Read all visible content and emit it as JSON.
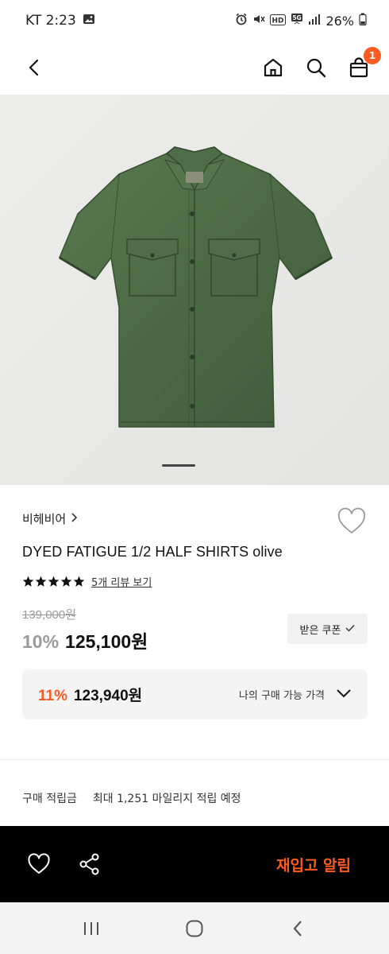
{
  "status_bar": {
    "carrier_time": "KT 2:23",
    "network": "5G",
    "hd": "HD",
    "battery": "26%"
  },
  "header": {
    "back_icon": "back-arrow-icon",
    "home_icon": "home-icon",
    "search_icon": "search-icon",
    "cart_icon": "shopping-bag-icon",
    "cart_count": "1",
    "accent_color": "#ff5a1f"
  },
  "product": {
    "brand": "비헤비어",
    "brand_chevron": "›",
    "name": "DYED FATIGUE 1/2 HALF SHIRTS olive",
    "rating_stars": 5,
    "review_link": "5개 리뷰 보기",
    "original_price": "139,000원",
    "discount_rate": "10%",
    "sale_price": "125,100원",
    "coupon_button": "받은 쿠폰",
    "image_slide": 1,
    "shirt_color": "#4d6b45"
  },
  "my_price": {
    "rate": "11%",
    "amount": "123,940원",
    "label": "나의 구매 가능 가격"
  },
  "points": {
    "label": "구매 적립금",
    "value": "최대 1,251 마일리지 적립 예정"
  },
  "action_bar": {
    "wishlist_icon": "heart-icon",
    "share_icon": "share-icon",
    "restock_label": "재입고 알림"
  },
  "system_nav": {
    "recents_icon": "recent-apps-icon",
    "home_icon": "home-circle-icon",
    "back_icon": "system-back-icon"
  }
}
